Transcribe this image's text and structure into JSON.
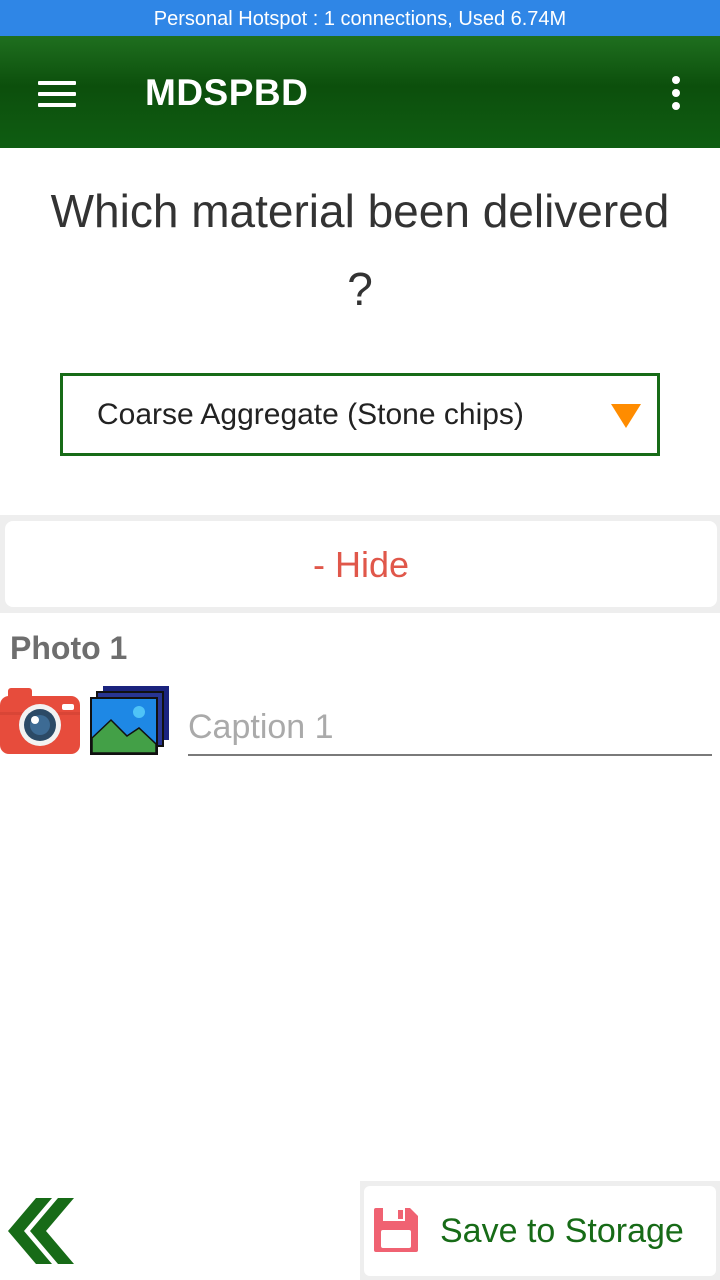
{
  "status_bar": {
    "text": "Personal Hotspot : 1 connections, Used 6.74M"
  },
  "app_bar": {
    "title": "MDSPBD",
    "menu_icon": "hamburger-menu-icon",
    "overflow_icon": "more-vert-icon"
  },
  "question": {
    "line1": "Which material been delivered",
    "line2": "?"
  },
  "material_select": {
    "selected": "Coarse Aggregate (Stone chips)",
    "arrow_icon": "dropdown-triangle-icon",
    "arrow_color": "#ff8c00"
  },
  "photos": {
    "toggle_label": "- Hide",
    "items": [
      {
        "label": "Photo 1",
        "caption_placeholder": "Caption 1",
        "caption_value": ""
      }
    ]
  },
  "footer": {
    "back_icon": "double-chevron-left-icon",
    "save_label": "Save to Storage",
    "save_icon": "floppy-disk-icon"
  },
  "colors": {
    "status_bar": "#2f86e6",
    "app_bar": "#0c4f0c",
    "accent_green": "#176b17",
    "hide_red": "#e0574a"
  }
}
